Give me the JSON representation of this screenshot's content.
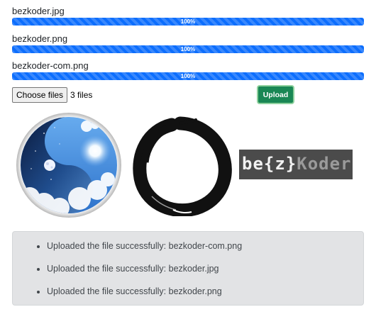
{
  "uploads": [
    {
      "file_name": "bezkoder.jpg",
      "progress_label": "100%",
      "progress": 100
    },
    {
      "file_name": "bezkoder.png",
      "progress_label": "100%",
      "progress": 100
    },
    {
      "file_name": "bezkoder-com.png",
      "progress_label": "100%",
      "progress": 100
    }
  ],
  "file_input": {
    "button_label": "Choose files",
    "status": "3 files"
  },
  "upload_button": {
    "label": "Upload"
  },
  "previews": {
    "image1": "yin-yang-sky-image",
    "image2": "enso-circle-image",
    "logo": {
      "part1": "be{z}",
      "part2": "Koder"
    }
  },
  "messages": [
    "Uploaded the file successfully: bezkoder-com.png",
    "Uploaded the file successfully: bezkoder.jpg",
    "Uploaded the file successfully: bezkoder.png"
  ],
  "colors": {
    "progress_bar": "#0d6efd",
    "upload_button": "#198754",
    "alert_background": "#e2e3e5"
  }
}
